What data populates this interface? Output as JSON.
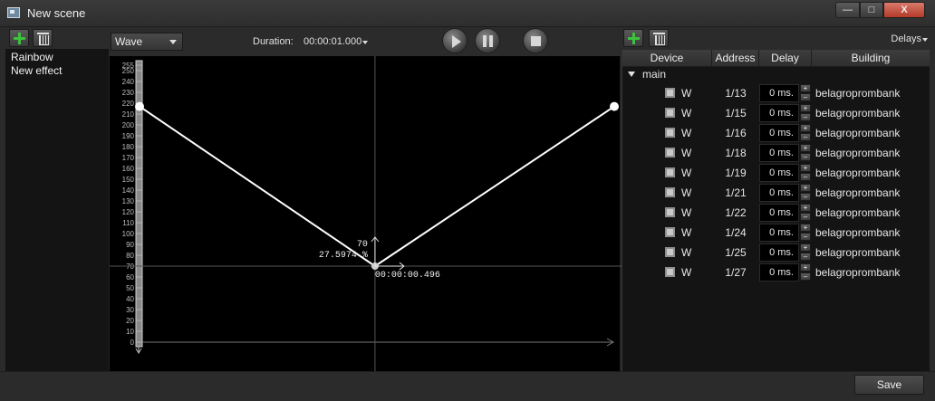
{
  "window": {
    "title": "New scene",
    "min_label": "—",
    "max_label": "□",
    "close_label": "X"
  },
  "effects": {
    "items": [
      "Rainbow",
      "New effect"
    ]
  },
  "editor": {
    "effect_type": "Wave",
    "duration_label": "Duration:",
    "duration_value": "00:00:01.000"
  },
  "graph": {
    "scale_labels": [
      "255",
      "250",
      "240",
      "230",
      "220",
      "210",
      "200",
      "190",
      "180",
      "170",
      "160",
      "150",
      "140",
      "130",
      "120",
      "110",
      "100",
      "90",
      "80",
      "70",
      "60",
      "50",
      "40",
      "30",
      "20",
      "10",
      "0"
    ],
    "cursor_value": "70",
    "cursor_percent": "27.5974 %",
    "cursor_time": "00:00:00.496",
    "keyframes": [
      {
        "time_fraction": 0.0,
        "value": 217
      },
      {
        "time_fraction": 0.496,
        "value": 70
      },
      {
        "time_fraction": 1.0,
        "value": 217
      }
    ]
  },
  "devices": {
    "delays_menu": "Delays",
    "columns": {
      "device": "Device",
      "address": "Address",
      "delay": "Delay",
      "building": "Building"
    },
    "group": "main",
    "rows": [
      {
        "name": "W",
        "address": "1/13",
        "delay": "0 ms.",
        "building": "belagroprombank"
      },
      {
        "name": "W",
        "address": "1/15",
        "delay": "0 ms.",
        "building": "belagroprombank"
      },
      {
        "name": "W",
        "address": "1/16",
        "delay": "0 ms.",
        "building": "belagroprombank"
      },
      {
        "name": "W",
        "address": "1/18",
        "delay": "0 ms.",
        "building": "belagroprombank"
      },
      {
        "name": "W",
        "address": "1/19",
        "delay": "0 ms.",
        "building": "belagroprombank"
      },
      {
        "name": "W",
        "address": "1/21",
        "delay": "0 ms.",
        "building": "belagroprombank"
      },
      {
        "name": "W",
        "address": "1/22",
        "delay": "0 ms.",
        "building": "belagroprombank"
      },
      {
        "name": "W",
        "address": "1/24",
        "delay": "0 ms.",
        "building": "belagroprombank"
      },
      {
        "name": "W",
        "address": "1/25",
        "delay": "0 ms.",
        "building": "belagroprombank"
      },
      {
        "name": "W",
        "address": "1/27",
        "delay": "0 ms.",
        "building": "belagroprombank"
      }
    ]
  },
  "footer": {
    "save_label": "Save"
  }
}
